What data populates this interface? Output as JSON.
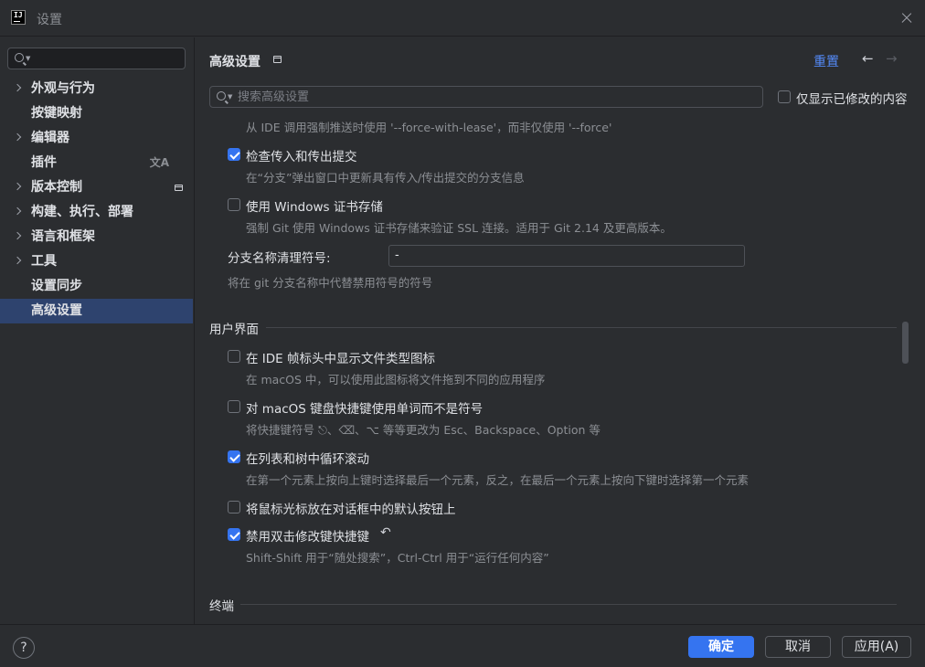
{
  "window": {
    "title": "设置",
    "logo": "IJ"
  },
  "sidebar": {
    "search_placeholder": "",
    "items": [
      {
        "label": "外观与行为",
        "expandable": true
      },
      {
        "label": "按键映射",
        "expandable": false
      },
      {
        "label": "编辑器",
        "expandable": true
      },
      {
        "label": "插件",
        "expandable": false,
        "icon": "translate-icon"
      },
      {
        "label": "版本控制",
        "expandable": true,
        "icon": "modified-badge-icon"
      },
      {
        "label": "构建、执行、部署",
        "expandable": true
      },
      {
        "label": "语言和框架",
        "expandable": true
      },
      {
        "label": "工具",
        "expandable": true
      },
      {
        "label": "设置同步",
        "expandable": false
      },
      {
        "label": "高级设置",
        "expandable": false,
        "selected": true
      }
    ]
  },
  "header": {
    "title": "高级设置",
    "reset_label": "重置",
    "back_icon": "←",
    "forward_icon": "→",
    "search_placeholder": "搜索高级设置",
    "show_modified_label": "仅显示已修改的内容"
  },
  "settings": {
    "force_lease_desc": "从 IDE 调用强制推送时使用 '--force-with-lease'，而非仅使用 '--force'",
    "incoming_outgoing": {
      "label": "检查传入和传出提交",
      "checked": true,
      "desc": "在“分支”弹出窗口中更新具有传入/传出提交的分支信息"
    },
    "windows_cert": {
      "label": "使用 Windows 证书存储",
      "checked": false,
      "desc": "强制 Git 使用 Windows 证书存储来验证 SSL 连接。适用于 Git 2.14 及更高版本。"
    },
    "branch_cleanup": {
      "label": "分支名称清理符号:",
      "value": "-",
      "desc": "将在 git 分支名称中代替禁用符号的符号"
    },
    "ui_section": "用户界面",
    "file_type_icon": {
      "label": "在 IDE 帧标头中显示文件类型图标",
      "checked": false,
      "desc": "在 macOS 中，可以使用此图标将文件拖到不同的应用程序"
    },
    "macos_shortcuts": {
      "label": "对 macOS 键盘快捷键使用单词而不是符号",
      "checked": false,
      "desc": "将快捷键符号 ⎋、⌫、⌥ 等等更改为 Esc、Backspace、Option 等"
    },
    "cyclic_scroll": {
      "label": "在列表和树中循环滚动",
      "checked": true,
      "desc": "在第一个元素上按向上键时选择最后一个元素，反之，在最后一个元素上按向下键时选择第一个元素"
    },
    "default_button": {
      "label": "将鼠标光标放在对话框中的默认按钮上",
      "checked": false
    },
    "double_modifier": {
      "label": "禁用双击修改键快捷键",
      "checked": true,
      "desc": "Shift-Shift 用于“随处搜索”，Ctrl-Ctrl 用于“运行任何内容”"
    },
    "terminal_section": "终端"
  },
  "footer": {
    "help_label": "?",
    "ok_label": "确定",
    "cancel_label": "取消",
    "apply_label": "应用(A)"
  },
  "colors": {
    "accent": "#3574f0",
    "link": "#548af7",
    "selection": "#2e436e",
    "background": "#2b2d30"
  }
}
